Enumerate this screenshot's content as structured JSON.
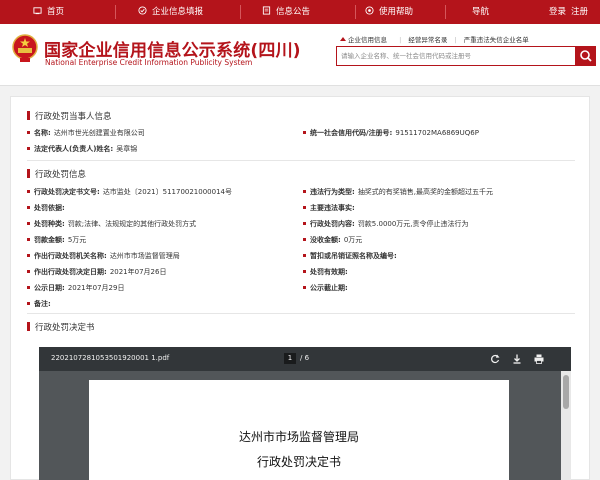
{
  "nav": {
    "home": "首页",
    "info_fill": "企业信息填报",
    "notice": "信息公告",
    "help": "使用帮助",
    "guide": "导航",
    "login": "登录",
    "register": "注册"
  },
  "header": {
    "title": "国家企业信用信息公示系统(四川)",
    "subtitle": "National Enterprise Credit Information Publicity System",
    "tabs": [
      "企业信用信息",
      "经营异常名录",
      "严重违法失信企业名单"
    ],
    "search_placeholder": "请输入企业名称、统一社会信用代码或注册号"
  },
  "party": {
    "section_title": "行政处罚当事人信息",
    "name_label": "名称:",
    "name_value": "达州市世光创建置业有限公司",
    "credit_label": "统一社会信用代码/注册号:",
    "credit_value": "91511702MA6869UQ6P",
    "rep_label": "法定代表人(负责人)姓名:",
    "rep_value": "吴章锦"
  },
  "penalty": {
    "section_title": "行政处罚信息",
    "decision_no_label": "行政处罚决定书文号:",
    "decision_no_value": "达市监处〔2021〕51170021000014号",
    "violation_type_label": "违法行为类型:",
    "violation_type_value": "抽奖式的有奖销售,最高奖的金额超过五千元",
    "category_label": "处罚依据:",
    "category_value": "",
    "facts_label": "主要违法事实:",
    "facts_value": "",
    "kind_label": "处罚种类:",
    "kind_value": "罚款;法律、法规规定的其他行政处罚方式",
    "content_label": "行政处罚内容:",
    "content_value": "罚款5.0000万元,责令停止违法行为",
    "fine_label": "罚款金额:",
    "fine_value": "5万元",
    "confiscation_label": "没收金额:",
    "confiscation_value": "0万元",
    "authority_label": "作出行政处罚机关名称:",
    "authority_value": "达州市市场监督管理局",
    "license_label": "暂扣或吊销证照名称及编号:",
    "license_value": "",
    "date_label": "作出行政处罚决定日期:",
    "date_value": "2021年07月26日",
    "other_label": "处罚有效期:",
    "other_value": "",
    "pub_date_label": "公示日期:",
    "pub_date_value": "2021年07月29日",
    "pub_end_label": "公示截止期:",
    "pub_end_value": "",
    "remark_label": "备注:",
    "remark_value": ""
  },
  "decision_doc": {
    "section_title": "行政处罚决定书",
    "file_name": "2202107281053501920001 1.pdf",
    "current_page": "1",
    "total_pages": "/ 6",
    "doc_title_1": "达州市市场监督管理局",
    "doc_title_2": "行政处罚决定书"
  },
  "colors": {
    "brand": "#b4141b",
    "pdf_toolbar": "#323639",
    "pdf_bg": "#525659"
  }
}
